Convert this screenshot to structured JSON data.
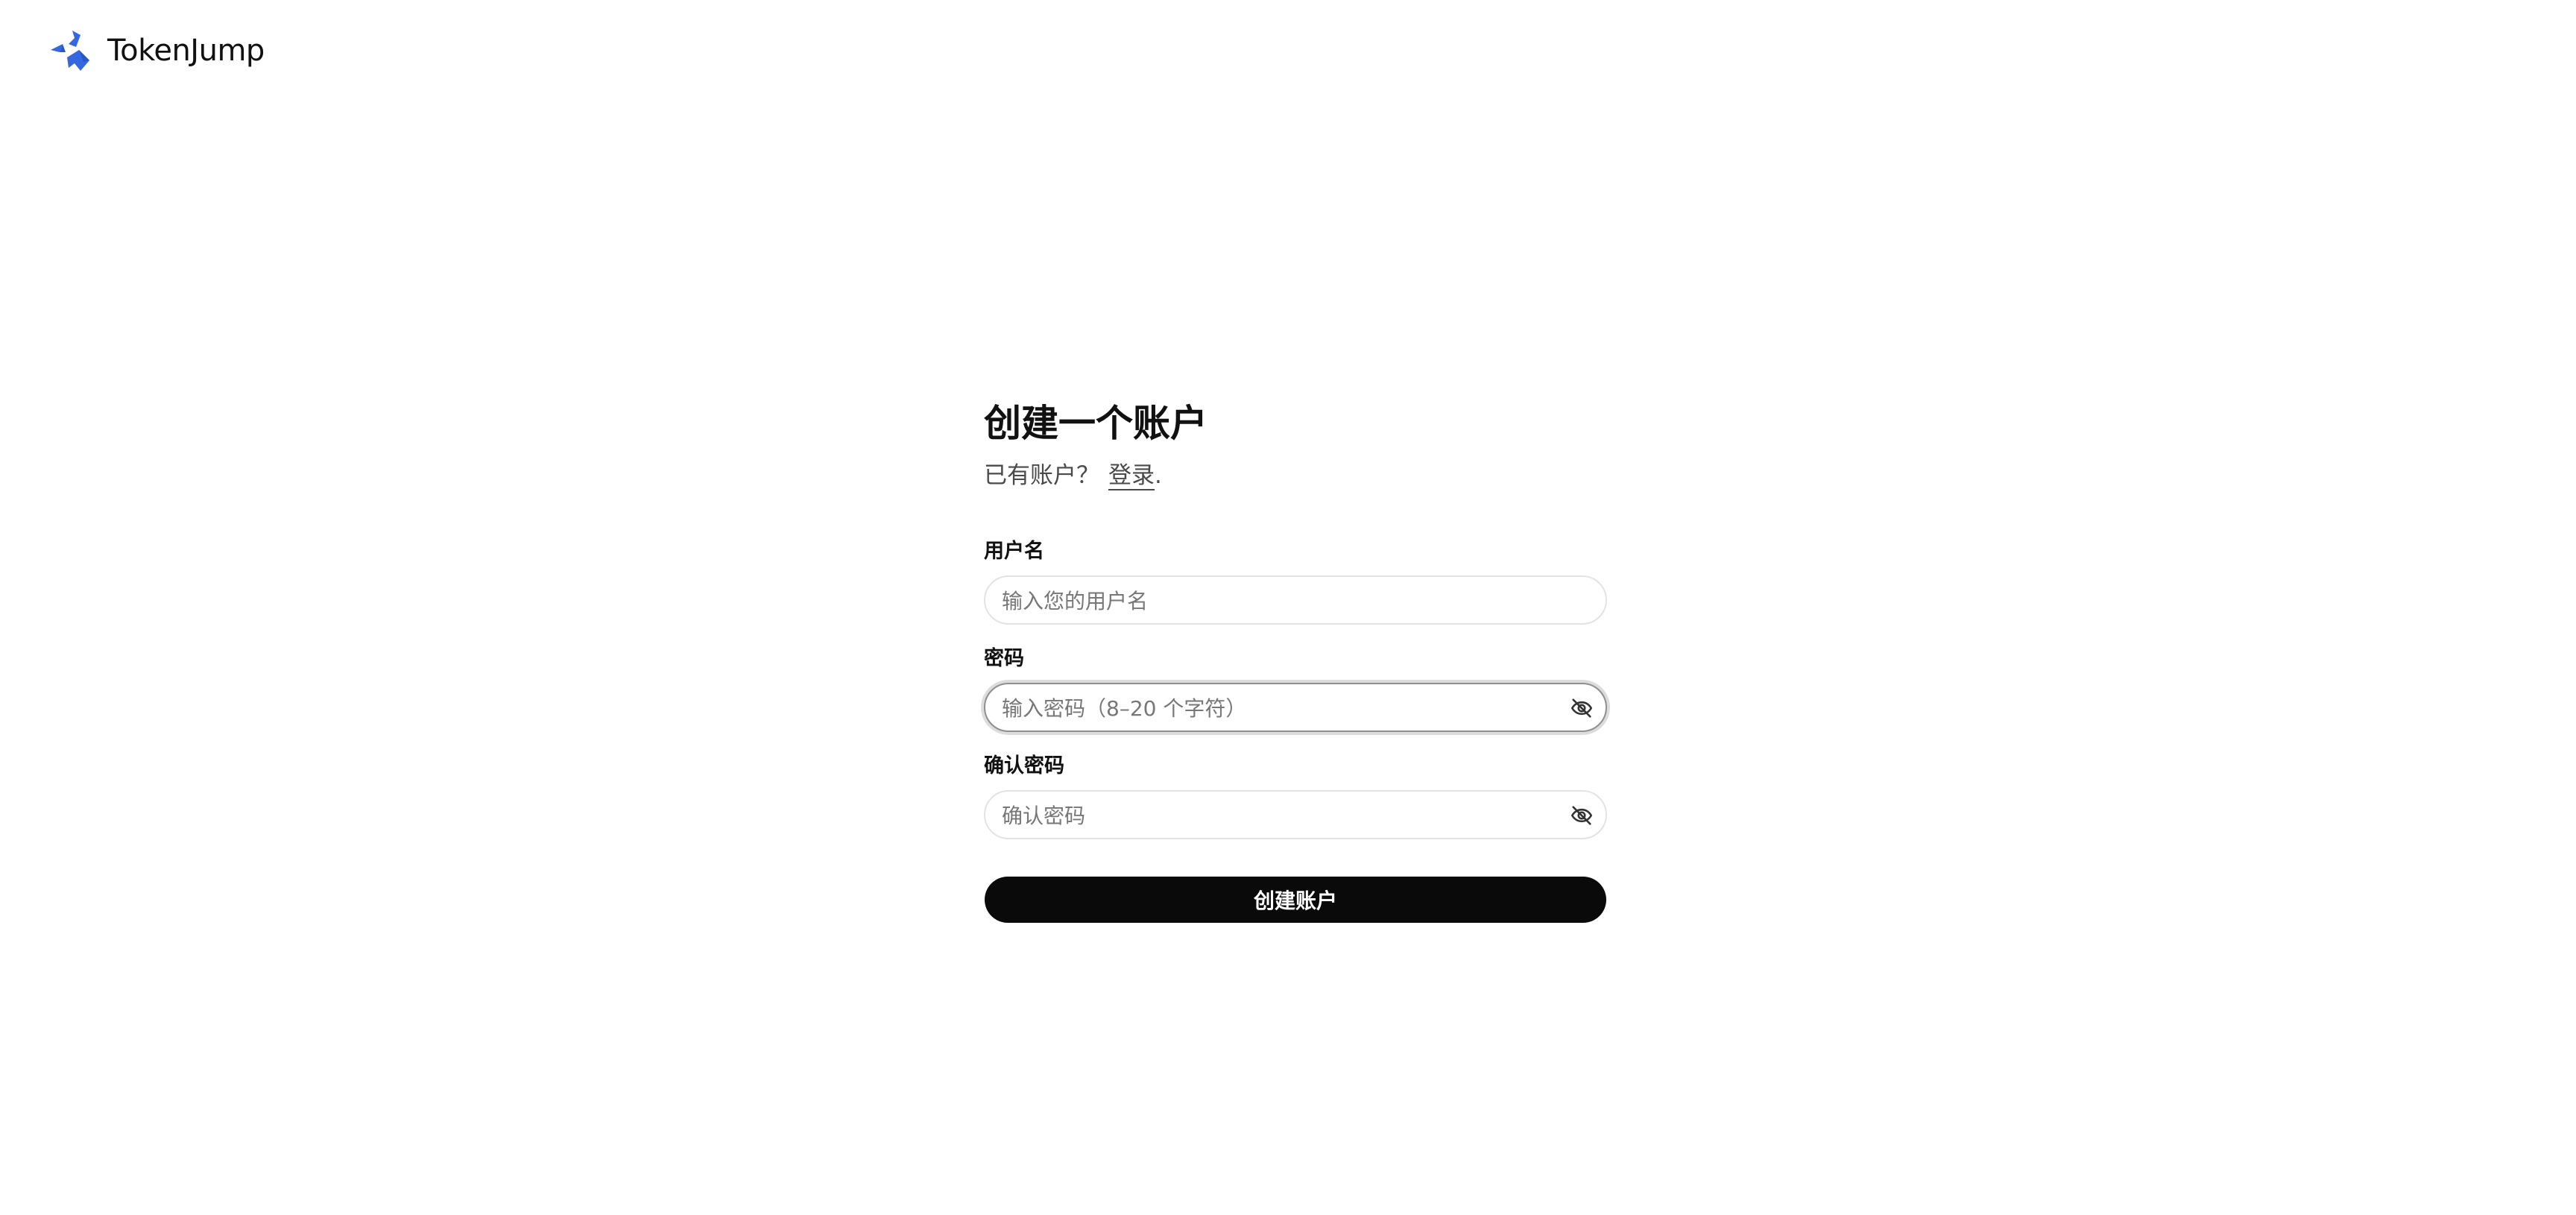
{
  "brand": {
    "name": "TokenJump",
    "logo_icon": "tokenjump-logo-icon",
    "logo_color": "#3568e0"
  },
  "form": {
    "title": "创建一个账户",
    "subtitle_prefix": "已有账户？",
    "login_link": "登录",
    "subtitle_suffix": ".",
    "fields": {
      "username": {
        "label": "用户名",
        "value": "",
        "placeholder": "输入您的用户名"
      },
      "password": {
        "label": "密码",
        "value": "",
        "placeholder": "输入密码（8–20 个字符）",
        "toggle_icon": "eye-off-icon",
        "focused": true
      },
      "confirm_password": {
        "label": "确认密码",
        "value": "",
        "placeholder": "确认密码",
        "toggle_icon": "eye-off-icon"
      }
    },
    "submit_label": "创建账户",
    "submit_color": "#0a0a0a"
  }
}
